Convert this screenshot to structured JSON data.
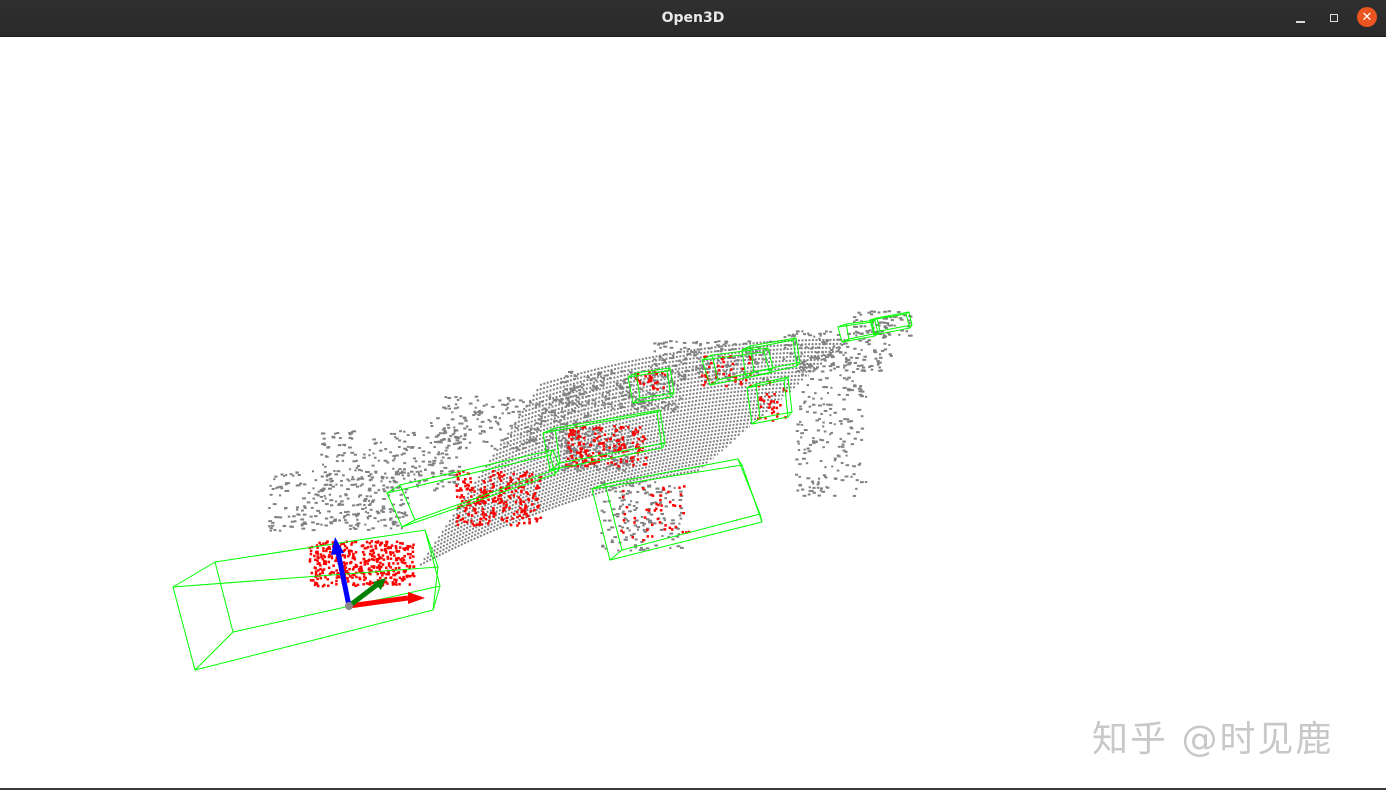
{
  "window": {
    "title": "Open3D"
  },
  "titlebar_buttons": {
    "minimize_icon": "minimize-icon",
    "maximize_icon": "maximize-icon",
    "close_icon": "close-icon",
    "close_color": "#e95420"
  },
  "scene": {
    "point_cloud_color": "#808080",
    "highlight_color": "#ff0000",
    "box_color": "#00ff00",
    "axis_colors": {
      "x": "#ff0000",
      "y": "#008000",
      "z": "#0000ff"
    },
    "bounding_box_count": 10
  },
  "watermark": {
    "text": "知乎 @时见鹿"
  }
}
